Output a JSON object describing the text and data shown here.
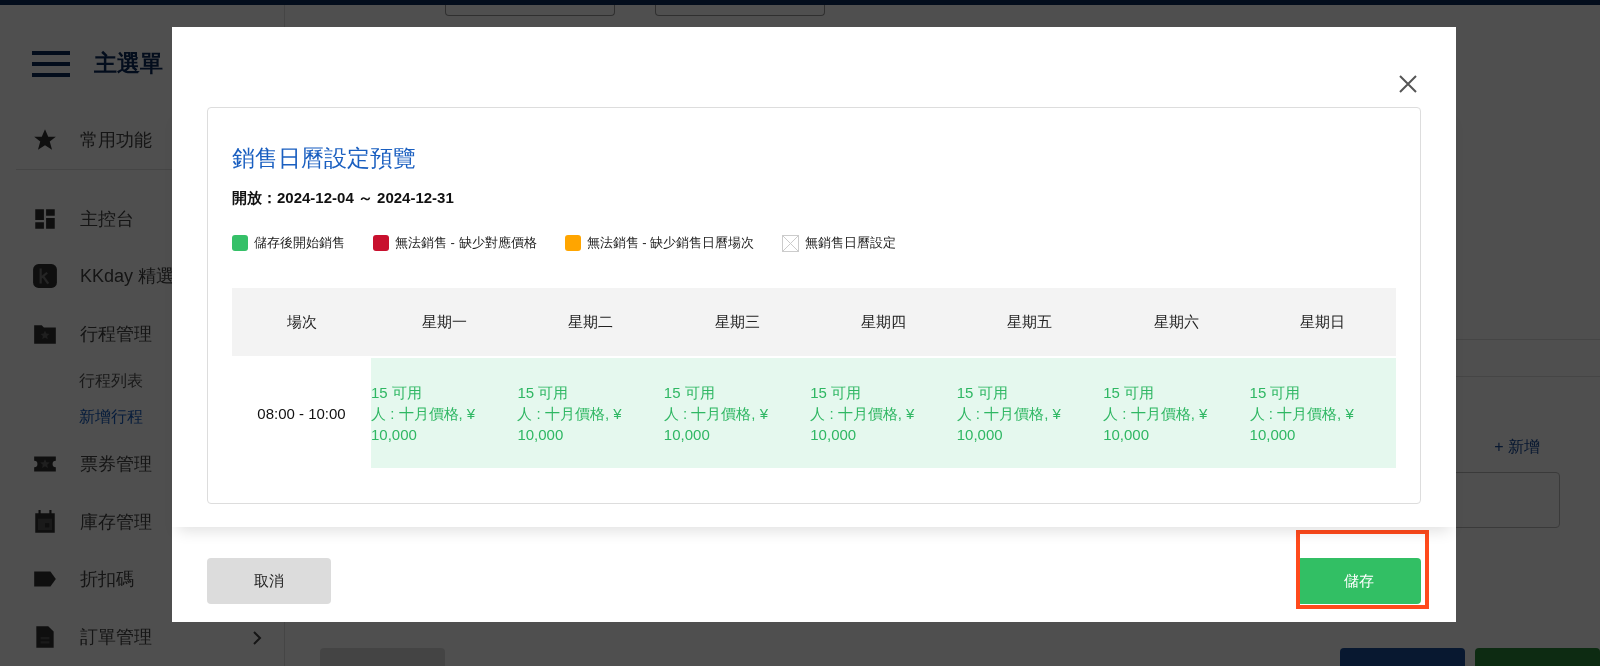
{
  "sidebar": {
    "title": "主選單",
    "items": [
      {
        "kind": "star",
        "label": "常用功能",
        "selected": false,
        "divider_after": true
      },
      {
        "kind": "dashboard",
        "label": "主控台",
        "selected": false
      },
      {
        "kind": "brand",
        "label": "KKday 精選",
        "selected": false
      },
      {
        "kind": "folder",
        "label": "行程管理",
        "selected": false,
        "children": [
          {
            "label": "行程列表",
            "selected": false
          },
          {
            "label": "新增行程",
            "selected": true
          }
        ]
      },
      {
        "kind": "ticket",
        "label": "票券管理",
        "selected": false
      },
      {
        "kind": "calendar",
        "label": "庫存管理",
        "selected": false
      },
      {
        "kind": "tag",
        "label": "折扣碼",
        "selected": false
      },
      {
        "kind": "document",
        "label": "訂單管理",
        "selected": false,
        "expandable": true
      }
    ]
  },
  "background": {
    "add_link": "+ 新增"
  },
  "modal": {
    "title": "銷售日曆設定預覽",
    "period": "**開放：2024-12-04 ～ 2024-12-31**",
    "legend": [
      {
        "kind": "swatch",
        "label": "儲存後開始銷售",
        "color": "#35c068"
      },
      {
        "kind": "swatch",
        "label": "無法銷售 - 缺少對應價格",
        "color": "#c8102e"
      },
      {
        "kind": "swatch",
        "label": "無法銷售 - 缺少銷售日曆場次",
        "color": "#ffa500"
      },
      {
        "kind": "crossed",
        "label": "無銷售日曆設定"
      }
    ],
    "table": {
      "columns": [
        "場次",
        "星期一",
        "星期二",
        "星期三",
        "星期四",
        "星期五",
        "星期六",
        "星期日"
      ],
      "rows": [
        {
          "cells": [
            {
              "kind": "session",
              "lines": [
                "08:00 - 10:00"
              ]
            },
            {
              "kind": "on_sale",
              "lines": [
                "15 可用",
                "人 : 十月價格, ¥",
                "10,000"
              ]
            },
            {
              "kind": "on_sale",
              "lines": [
                "15 可用",
                "人 : 十月價格, ¥",
                "10,000"
              ]
            },
            {
              "kind": "on_sale",
              "lines": [
                "15 可用",
                "人 : 十月價格, ¥",
                "10,000"
              ]
            },
            {
              "kind": "on_sale",
              "lines": [
                "15 可用",
                "人 : 十月價格, ¥",
                "10,000"
              ]
            },
            {
              "kind": "on_sale",
              "lines": [
                "15 可用",
                "人 : 十月價格, ¥",
                "10,000"
              ]
            },
            {
              "kind": "on_sale",
              "lines": [
                "15 可用",
                "人 : 十月價格, ¥",
                "10,000"
              ]
            },
            {
              "kind": "on_sale",
              "lines": [
                "15 可用",
                "人 : 十月價格, ¥",
                "10,000"
              ]
            }
          ]
        }
      ]
    },
    "cancel_button": "取消",
    "save_button": "儲存",
    "save_highlighted": true
  }
}
